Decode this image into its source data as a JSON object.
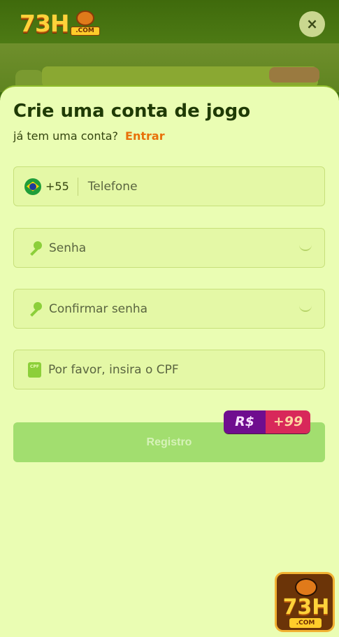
{
  "header": {
    "logo_number": "73H",
    "logo_suffix": ".COM",
    "close_label": "×"
  },
  "form": {
    "title": "Crie uma conta de jogo",
    "login_prompt": "já tem uma conta?",
    "login_link": "Entrar",
    "phone": {
      "country_code": "+55",
      "placeholder": "Telefone"
    },
    "password": {
      "placeholder": "Senha"
    },
    "confirm_password": {
      "placeholder": "Confirmar senha"
    },
    "cpf": {
      "placeholder": "Por favor, insira o CPF",
      "icon_text": "CPF"
    },
    "register_label": "Registro",
    "bonus": {
      "currency": "R$",
      "amount": "+99"
    }
  },
  "app_badge": {
    "number": "73H",
    "suffix": ".COM"
  },
  "colors": {
    "sheet_bg": "#eafdb3",
    "field_bg": "#e4f8a6",
    "accent_link": "#e8700a",
    "button": "#a2de6f",
    "title": "#1f3a05"
  }
}
